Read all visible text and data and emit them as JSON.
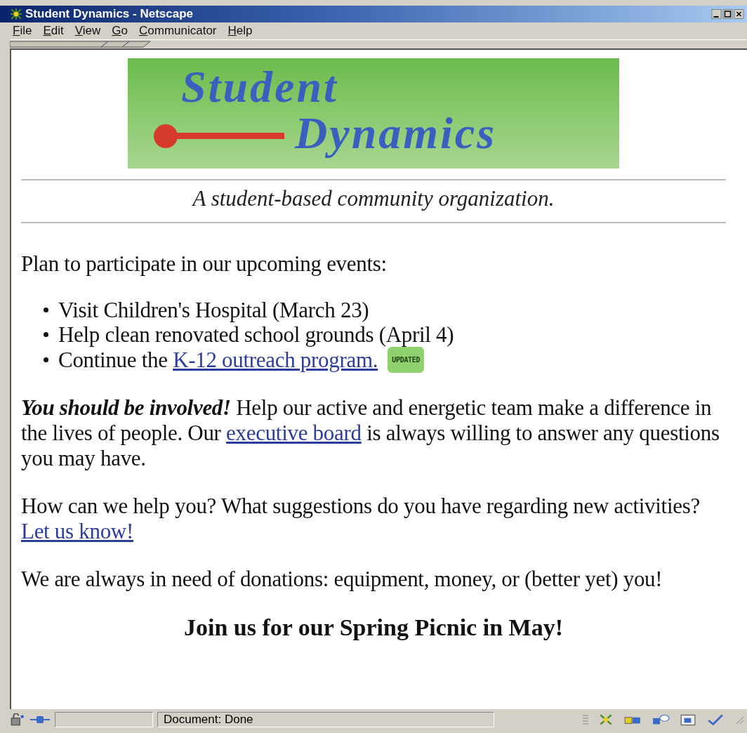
{
  "window": {
    "title": "Student Dynamics - Netscape"
  },
  "menu": [
    {
      "label": "File"
    },
    {
      "label": "Edit"
    },
    {
      "label": "View"
    },
    {
      "label": "Go"
    },
    {
      "label": "Communicator"
    },
    {
      "label": "Help"
    }
  ],
  "banner": {
    "line_1": "Student",
    "line_2": "Dynamics"
  },
  "tagline": "A student-based community organization.",
  "intro": "Plan to participate in our upcoming events:",
  "events": [
    {
      "text": "Visit Children's Hospital (March 23)"
    },
    {
      "text": "Help clean renovated school grounds (April 4)"
    },
    {
      "text": "Continue the ",
      "link": "K-12 outreach program.",
      "badge": "UPDATED"
    }
  ],
  "involved": {
    "lead": "You should be involved!",
    "before": " Help our active and energetic team make a difference in the lives of people. Our ",
    "link": "executive board",
    "after": " is always willing to answer any questions you may have."
  },
  "feedback": {
    "text": "How can we help you? What suggestions do you have regarding new activities?",
    "link": "Let us know!"
  },
  "donations": "We are always in need of donations: equipment, money, or (better yet) you!",
  "closing": "Join us for our Spring Picnic in May!",
  "status_bar": {
    "message": "Document: Done"
  }
}
